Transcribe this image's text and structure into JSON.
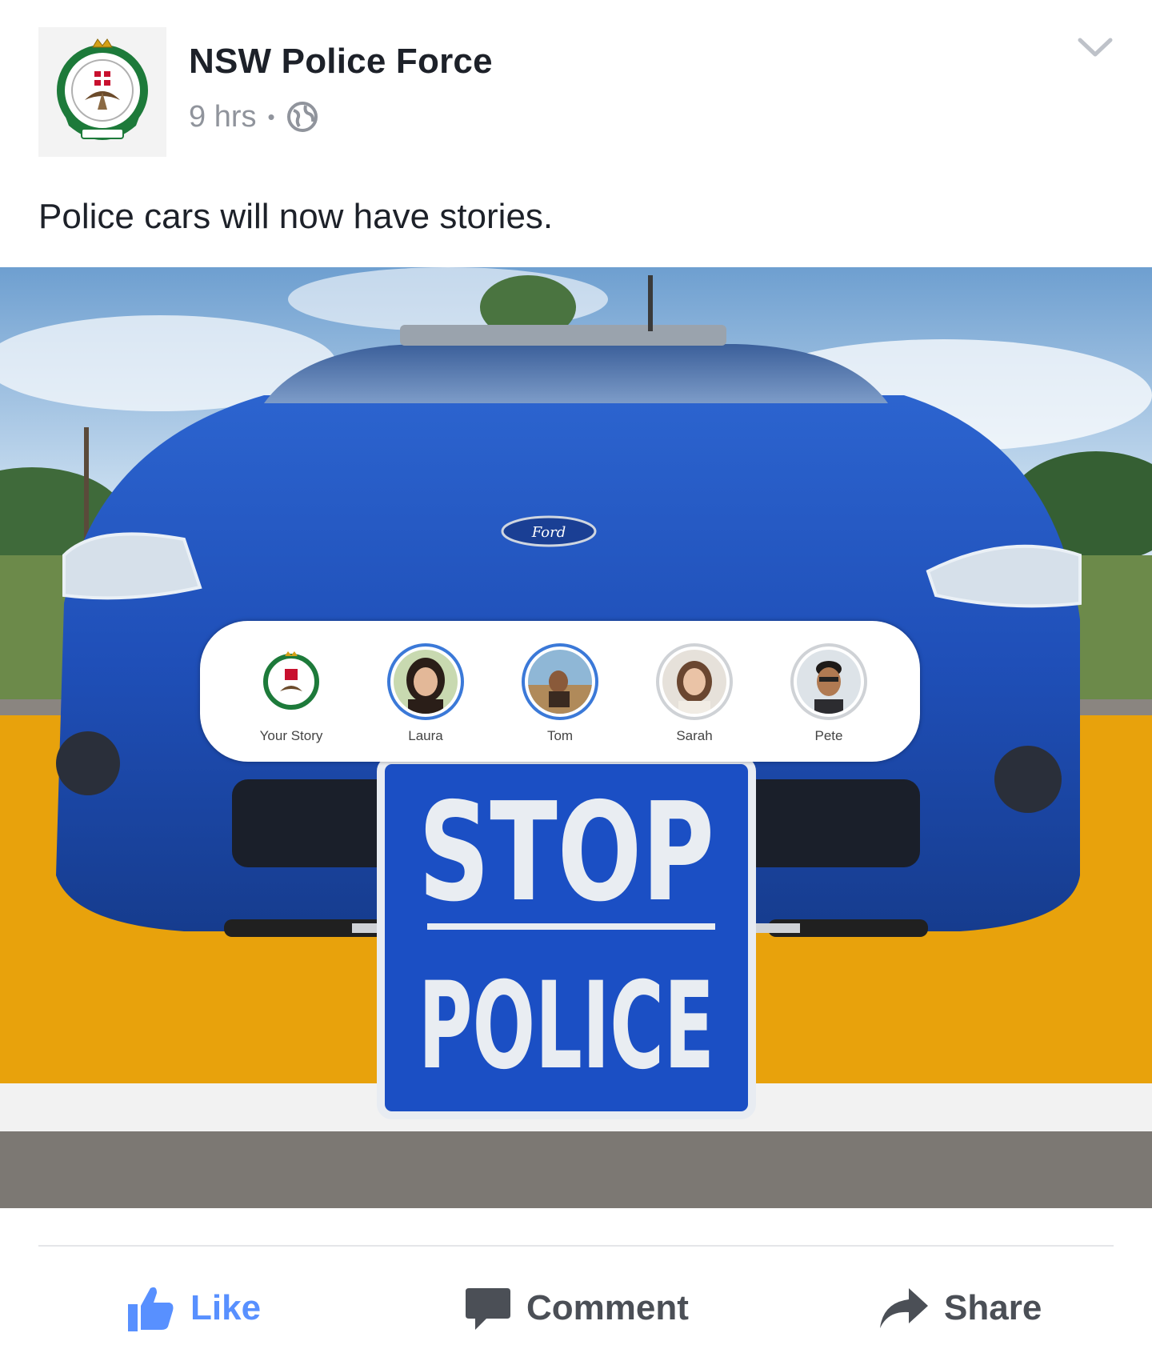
{
  "post": {
    "page_name": "NSW Police Force",
    "time_ago": "9 hrs",
    "meta_separator": "•",
    "privacy_icon": "globe-icon",
    "menu_icon": "chevron-down-icon",
    "text": "Police cars will now have stories."
  },
  "photo": {
    "stories": [
      {
        "label": "Your Story",
        "ring": "own"
      },
      {
        "label": "Laura",
        "ring": "new"
      },
      {
        "label": "Tom",
        "ring": "new"
      },
      {
        "label": "Sarah",
        "ring": "seen"
      },
      {
        "label": "Pete",
        "ring": "seen"
      }
    ],
    "sign_line1": "STOP",
    "sign_line2": "POLICE",
    "car_badge": "Ford",
    "colors": {
      "car_blue": "#1f4fb8",
      "sign_blue": "#1b4fc4",
      "bay_yellow": "#e8a20c"
    }
  },
  "actions": {
    "like_label": "Like",
    "comment_label": "Comment",
    "share_label": "Share",
    "like_color": "#5890ff",
    "icon_color": "#4b4f56"
  }
}
